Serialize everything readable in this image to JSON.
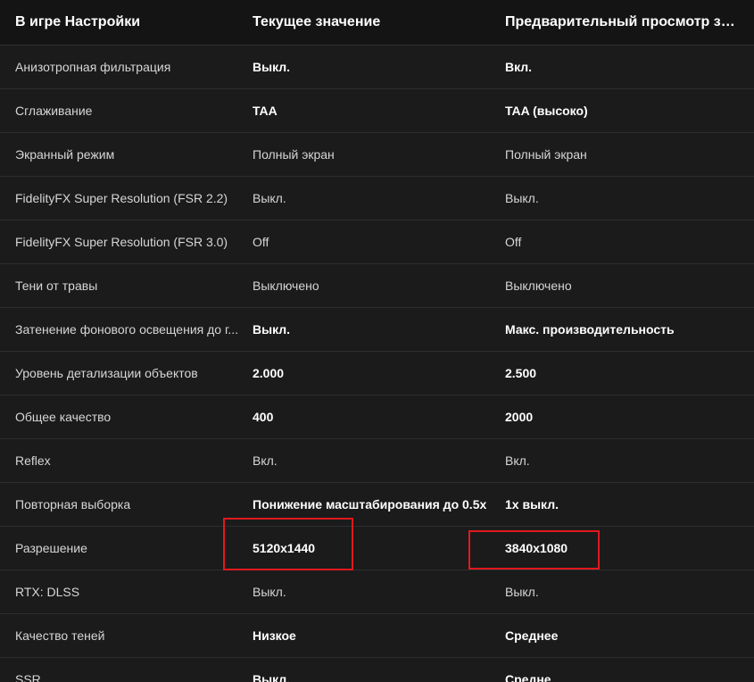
{
  "header": {
    "col_setting": "В игре Настройки",
    "col_current": "Текущее значение",
    "col_preview": "Предварительный просмотр зна..."
  },
  "rows": [
    {
      "setting": "Анизотропная фильтрация",
      "current": "Выкл.",
      "preview": "Вкл.",
      "current_bold": true,
      "preview_bold": true
    },
    {
      "setting": "Сглаживание",
      "current": "TAA",
      "preview": "TAA (высоко)",
      "current_bold": true,
      "preview_bold": true
    },
    {
      "setting": "Экранный режим",
      "current": "Полный экран",
      "preview": "Полный экран",
      "current_bold": false,
      "preview_bold": false
    },
    {
      "setting": "FidelityFX Super Resolution (FSR 2.2)",
      "current": "Выкл.",
      "preview": "Выкл.",
      "current_bold": false,
      "preview_bold": false
    },
    {
      "setting": "FidelityFX Super Resolution (FSR 3.0)",
      "current": "Off",
      "preview": "Off",
      "current_bold": false,
      "preview_bold": false
    },
    {
      "setting": "Тени от травы",
      "current": "Выключено",
      "preview": "Выключено",
      "current_bold": false,
      "preview_bold": false
    },
    {
      "setting": "Затенение фонового освещения до г...",
      "current": "Выкл.",
      "preview": "Макс. производительность",
      "current_bold": true,
      "preview_bold": true
    },
    {
      "setting": "Уровень детализации объектов",
      "current": "2.000",
      "preview": "2.500",
      "current_bold": true,
      "preview_bold": true
    },
    {
      "setting": "Общее качество",
      "current": "400",
      "preview": "2000",
      "current_bold": true,
      "preview_bold": true
    },
    {
      "setting": "Reflex",
      "current": "Вкл.",
      "preview": "Вкл.",
      "current_bold": false,
      "preview_bold": false
    },
    {
      "setting": "Повторная выборка",
      "current": "Понижение масштабирования до 0.5x",
      "preview": "1x выкл.",
      "current_bold": true,
      "preview_bold": true
    },
    {
      "setting": "Разрешение",
      "current": "5120x1440",
      "preview": "3840x1080",
      "current_bold": true,
      "preview_bold": true
    },
    {
      "setting": "RTX: DLSS",
      "current": "Выкл.",
      "preview": "Выкл.",
      "current_bold": false,
      "preview_bold": false
    },
    {
      "setting": "Качество теней",
      "current": "Низкое",
      "preview": "Среднее",
      "current_bold": true,
      "preview_bold": true
    },
    {
      "setting": "SSR",
      "current": "Выкл.",
      "preview": "Средне",
      "current_bold": true,
      "preview_bold": true
    }
  ],
  "annotation": {
    "color": "#e0191e"
  }
}
